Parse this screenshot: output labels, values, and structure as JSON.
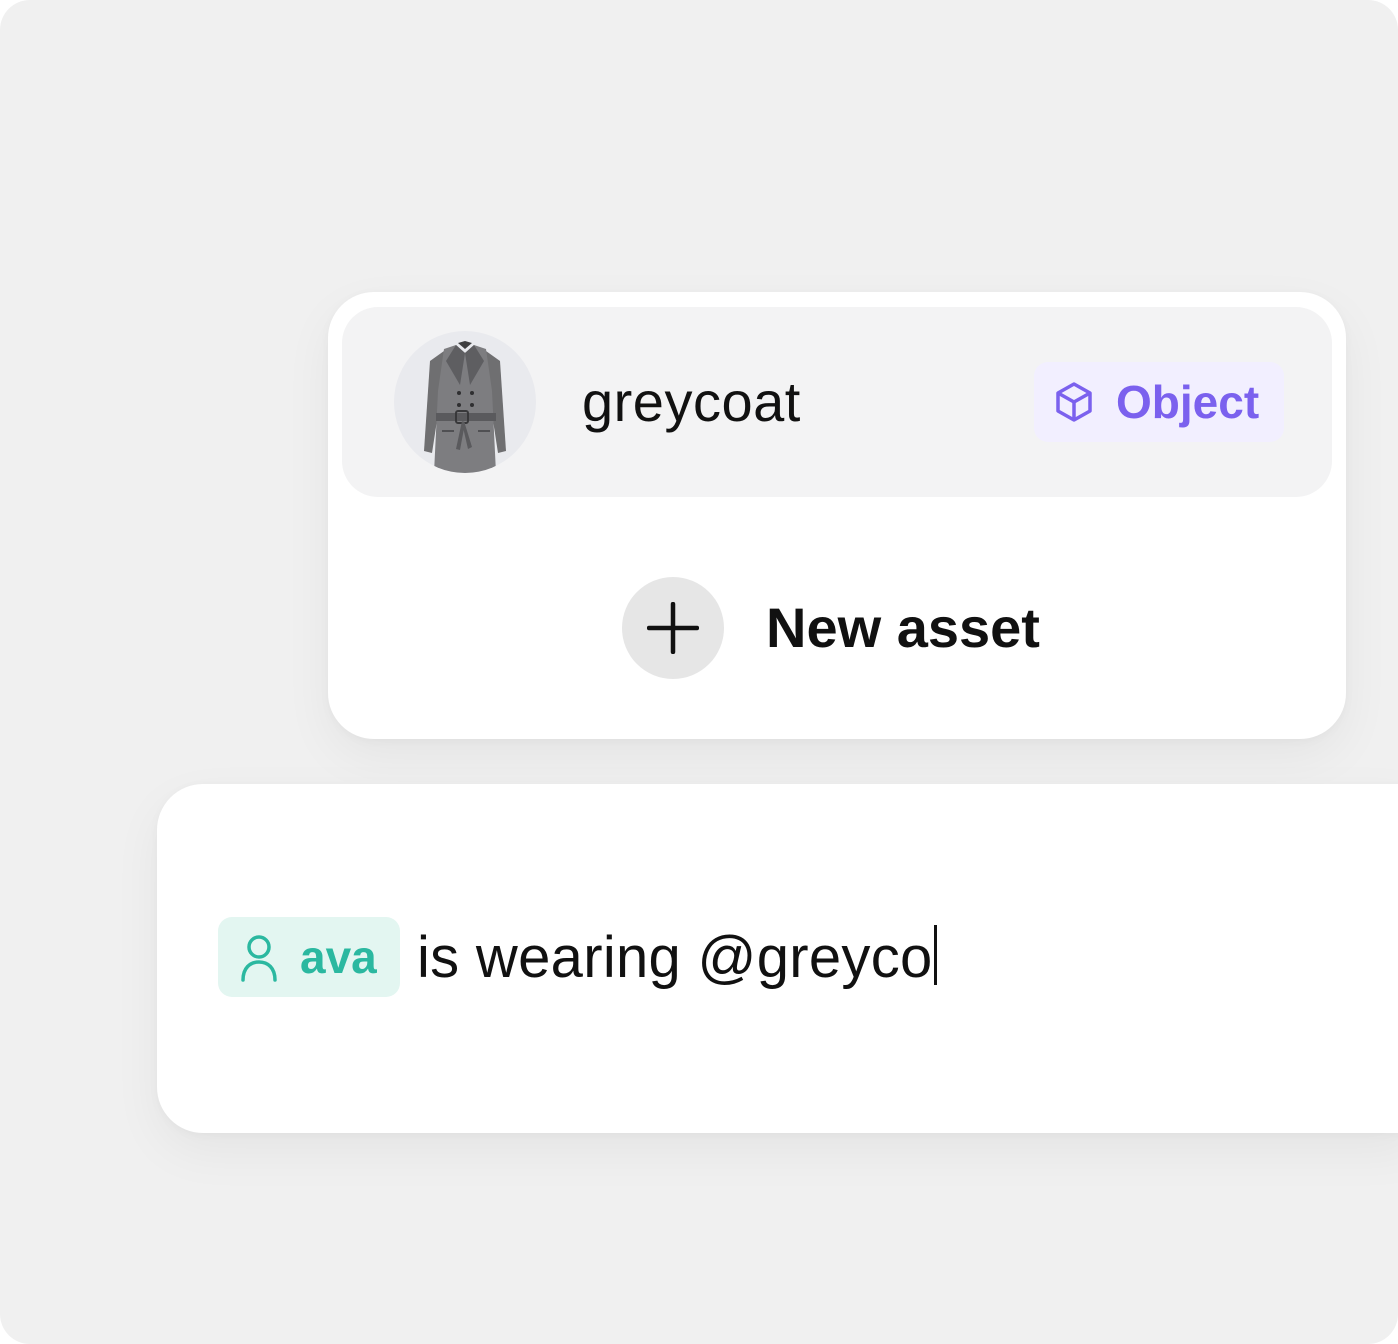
{
  "suggestions": {
    "items": [
      {
        "name": "greycoat",
        "type_label": "Object",
        "type_icon": "cube-icon",
        "thumbnail": "grey-coat-image"
      }
    ],
    "new_asset_label": "New asset",
    "new_asset_icon": "plus-icon"
  },
  "prompt": {
    "mention": {
      "label": "ava",
      "icon": "person-icon"
    },
    "text": "is wearing @greyco"
  },
  "colors": {
    "background": "#f0f0f0",
    "object_badge_bg": "#f2efff",
    "object_badge_fg": "#7b61ee",
    "character_chip_bg": "#e3f6f1",
    "character_chip_fg": "#2bb8a0"
  }
}
